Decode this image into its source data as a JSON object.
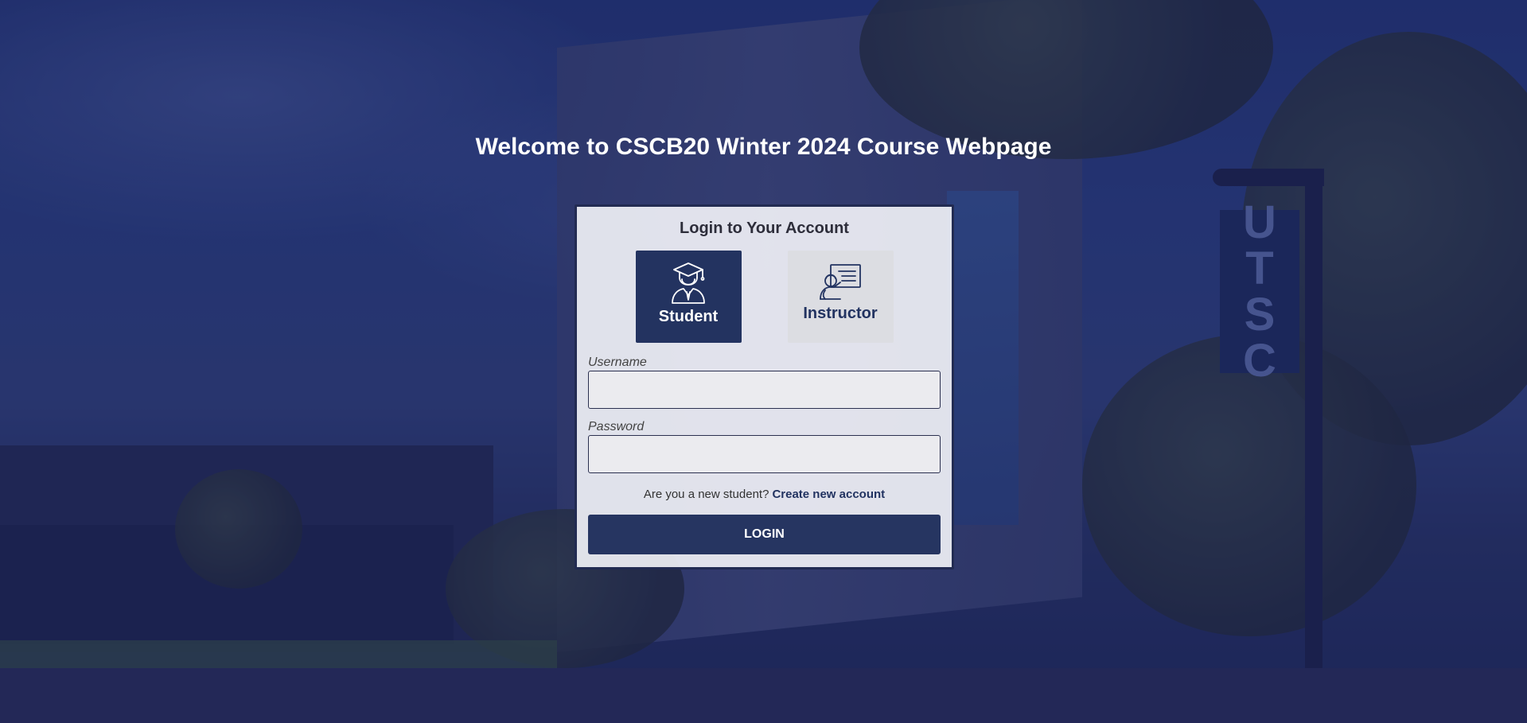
{
  "page": {
    "title": "Welcome to CSCB20 Winter 2024 Course Webpage",
    "background_banner": [
      "U",
      "T",
      "S",
      "C"
    ]
  },
  "login": {
    "heading": "Login to Your Account",
    "roles": [
      {
        "label": "Student",
        "icon": "graduate-icon",
        "selected": true
      },
      {
        "label": "Instructor",
        "icon": "teacher-board-icon",
        "selected": false
      }
    ],
    "username": {
      "label": "Username",
      "value": "",
      "placeholder": ""
    },
    "password": {
      "label": "Password",
      "value": "",
      "placeholder": ""
    },
    "signup_prompt": "Are you a new student?",
    "signup_link": "Create new account",
    "submit_label": "LOGIN"
  },
  "colors": {
    "accent": "#233360",
    "inactive_role_bg": "#dcdde2",
    "overlay": "#1a225a"
  }
}
